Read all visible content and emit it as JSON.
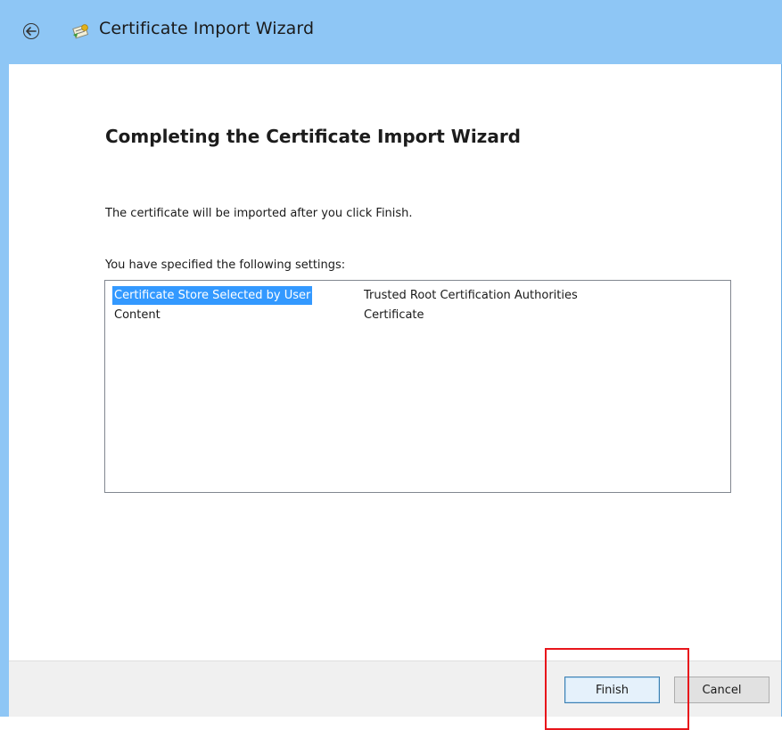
{
  "window": {
    "title": "Certificate Import Wizard",
    "back_icon": "back-arrow-icon",
    "app_icon": "certificate-icon"
  },
  "wizard": {
    "heading": "Completing the Certificate Import Wizard",
    "info_text": "The certificate will be imported after you click Finish.",
    "settings_label": "You have specified the following settings:",
    "settings": [
      {
        "key": "Certificate Store Selected by User",
        "value": "Trusted Root Certification Authorities",
        "selected": true
      },
      {
        "key": "Content",
        "value": "Certificate",
        "selected": false
      }
    ]
  },
  "footer": {
    "finish_label": "Finish",
    "cancel_label": "Cancel"
  },
  "colors": {
    "titlebar": "#8ec6f5",
    "selection": "#3399ff",
    "highlight_annotation": "#e8151b"
  }
}
